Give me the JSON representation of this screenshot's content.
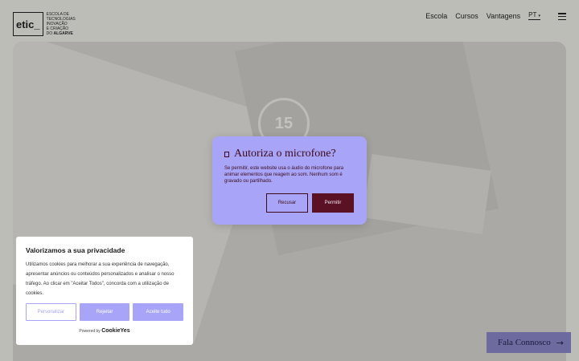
{
  "header": {
    "logo_mark": "etic_",
    "logo_line1": "Escola de",
    "logo_line2": "Tecnologias",
    "logo_line3": "Inovação",
    "logo_line4": "e Criação",
    "logo_line5_prefix": "do",
    "logo_line5_bold": "Algarve",
    "nav": [
      "Escola",
      "Cursos",
      "Vantagens"
    ],
    "lang": "PT"
  },
  "hero": {
    "badge_number": "15"
  },
  "mic_modal": {
    "icon": "microphone-icon",
    "title": "Autoriza o microfone?",
    "description": "Se permitir, este website usa o áudio do microfone para animar elementos que reagem ao som. Nenhum som é gravado ou partilhado.",
    "refuse_label": "Recusar",
    "allow_label": "Permitir"
  },
  "cookie": {
    "title": "Valorizamos a sua privacidade",
    "text": "Utilizamos cookies para melhorar a sua experiência de navegação, apresentar anúncios ou conteúdos personalizados e analisar o nosso tráfego. Ao clicar em \"Aceitar Todos\", concorda com a utilização de cookies.",
    "personalize_label": "Personalizar",
    "reject_label": "Rejeitar",
    "accept_label": "Aceite tudo",
    "powered_by": "Powered by",
    "powered_brand": "CookieYes"
  },
  "contact": {
    "label": "Fala Connosco",
    "icon": "arrow-right-icon"
  },
  "colors": {
    "accent": "#a8a5f8",
    "dark": "#3e0a19",
    "allow": "#5b1124"
  }
}
